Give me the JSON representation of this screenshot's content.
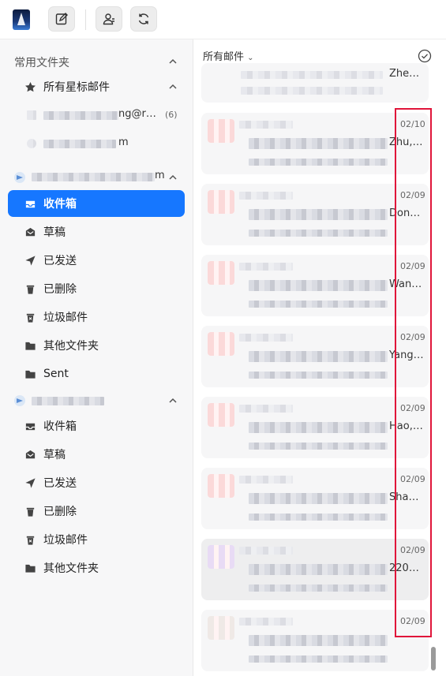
{
  "toolbar": {
    "logo_icon": "app-logo",
    "buttons": [
      {
        "name": "compose",
        "icon": "edit-icon"
      },
      {
        "name": "contacts",
        "icon": "contacts-icon"
      },
      {
        "name": "sync",
        "icon": "refresh-icon"
      }
    ]
  },
  "sidebar": {
    "favorites_header": "常用文件夹",
    "starred_label": "所有星标邮件",
    "fav_account1_text": "ng@r…",
    "fav_account1_count": "(6)",
    "fav_account2_text": "m",
    "account1_text": "m",
    "account1_folders": [
      {
        "label": "收件箱",
        "icon": "inbox-icon",
        "active": true
      },
      {
        "label": "草稿",
        "icon": "drafts-icon"
      },
      {
        "label": "已发送",
        "icon": "sent-icon"
      },
      {
        "label": "已删除",
        "icon": "trash-icon"
      },
      {
        "label": "垃圾邮件",
        "icon": "spam-icon"
      },
      {
        "label": "其他文件夹",
        "icon": "folder-icon"
      },
      {
        "label": "Sent",
        "icon": "folder-icon"
      }
    ],
    "account2_folders": [
      {
        "label": "收件箱",
        "icon": "inbox-icon"
      },
      {
        "label": "草稿",
        "icon": "drafts-icon"
      },
      {
        "label": "已发送",
        "icon": "sent-icon"
      },
      {
        "label": "已删除",
        "icon": "trash-icon"
      },
      {
        "label": "垃圾邮件",
        "icon": "spam-icon"
      },
      {
        "label": "其他文件夹",
        "icon": "folder-icon"
      }
    ]
  },
  "list": {
    "filter_label": "所有邮件",
    "top_partial_text": "Zhe…",
    "mails": [
      {
        "date": "02/10",
        "sender_end": "Zhu,…"
      },
      {
        "date": "02/09",
        "sender_end": "Don…"
      },
      {
        "date": "02/09",
        "sender_end": "Wan…"
      },
      {
        "date": "02/09",
        "sender_end": "Yang…"
      },
      {
        "date": "02/09",
        "sender_end": "Hao,…"
      },
      {
        "date": "02/09",
        "sender_end": "Sha…"
      },
      {
        "date": "02/09",
        "sender_end": "220…",
        "selected": true
      },
      {
        "date": "02/09",
        "sender_end": ""
      }
    ]
  },
  "colors": {
    "accent": "#1677ff",
    "highlight_box": "#e0153a"
  }
}
